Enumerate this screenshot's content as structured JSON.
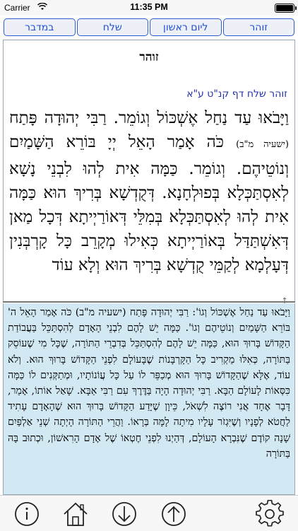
{
  "status_bar": {
    "carrier": "Carrier",
    "time": "11:35 PM"
  },
  "tabs": [
    {
      "label": "במדבר"
    },
    {
      "label": "שלח"
    },
    {
      "label": "ליום ראשון"
    },
    {
      "label": "זוהר"
    }
  ],
  "upper_pane": {
    "title": "זוהר",
    "reference": "זוהר שלח דף קנ\"ט ע\"א",
    "text_a": "וַיָּבֹאוּ עַד נַחַל אֶשְׁכּוֹל וְגוֹמֵר. רַבִּי יְהוּדָה פָּתַח",
    "inline_citation": "(ישעיה מ\"ב)",
    "text_b": "כֹּה אָמַר הָאֵל יְיָ בּוֹרֵא הַשָּׁמַיִם וְנוֹטֵיהֶם. וְגוֹמֵר. כַּמָּה אִית לְהוּ לִבְנֵי נָשָׁא לְאִסְתַּכְּלָא בְּפוּלְחָנָא. דְּקֻדְשָׁא בְּרִיךְ הוּא כַּמָּה אִית לְהוּ לְאִסְתַּכְּלָא בְּמִלֵּי דְּאוֹרַיְיתָא דְּכָל מַאן דְּאִשְׁתַּדַּל בְּאוֹרַיְיתָא כְּאִילוּ מְקָרֵב כָּל קָרְבְּנִין דְּעָלְמָא לְקַמֵּי קֻדְשָׁא בְּרִיךְ הוּא וְלָא עוֹד"
  },
  "lower_pane": {
    "text": "וַיָּבֹאוּ עַד נַחַל אֶשְׁכּוֹל וְגוֹ': רַבִּי יְהוּדָה פָּתַח (ישעיה מ\"ב) כֹּה אָמַר הָאֵל ה' בּוֹרֵא הַשָּׁמַיִם וְנוֹטֵיהֶם וְגוֹ'. כַּמָּה יֵשׁ לָהֶם לִבְנֵי הָאָדָם לְהִסְתַּכֵּל בַּעֲבוֹדַת הַקָּדוֹשׁ בָּרוּךְ הוּא, כַּמָּה יֵשׁ לָהֶם לְהִסְתַּכֵּל בְּדִבְרֵי הַתּוֹרָה, שֶׁכָּל מִי שֶׁעוֹסֵק בַּתּוֹרָה, כְּאִלּוּ מַקְרִיב כָּל הַקָּרְבָּנוֹת שֶׁבָּעוֹלָם לִפְנֵי הַקָּדוֹשׁ בָּרוּךְ הוּא. וְלֹא עוֹד, אֶלָּא שֶׁהַקָּדוֹשׁ בָּרוּךְ הוּא מְכַפֵּר לוֹ עַל כָּל עֲוֹנוֹתָיו, וּמְתַקְּנִים לוֹ כַּמָּה כִּסְּאוֹת לָעוֹלָם הַבָּא. רַבִּי יְהוּדָה הָיָה בַּדֶּרֶךְ עִם רַבִּי אַבָּא. שָׁאַל אוֹתוֹ, אָמַר, דָּבָר אֶחָד אֲנִי רוֹצֶה לִשְׁאֹל, כֵּיוָן שֶׁיָּדַע הַקָּדוֹשׁ בָּרוּךְ הוּא שֶׁהָאָדָם עָתִיד לַחֲטֹא לְפָנָיו וְשֶׁיִּגְזֹר עָלָיו מִיתָה לָמָּה בְּרָאוֹ. וַהֲרֵי הַתּוֹרָה הָיְתָה שְׁנֵי אַלְפַּיִם שָׁנָה קוֹדֶם שֶׁנִּבְרָא הָעוֹלָם, דְּהַיְנוּ לִפְנֵי חֶטְאוֹ שֶׁל אָדָם הָרִאשׁוֹן, וּכְתוּב בָּהּ בַּתּוֹרָה"
  },
  "toolbar": {
    "buttons": [
      {
        "icon": "info-icon"
      },
      {
        "icon": "home-icon"
      },
      {
        "icon": "arrow-down-circle-icon"
      },
      {
        "icon": "arrow-up-circle-icon"
      },
      {
        "icon": "gear-icon"
      }
    ]
  },
  "colors": {
    "accent": "#1f4fd6",
    "tab_bg": "#eef0f7",
    "translation_bg": "#d2e8f3",
    "reference": "#2233aa"
  }
}
